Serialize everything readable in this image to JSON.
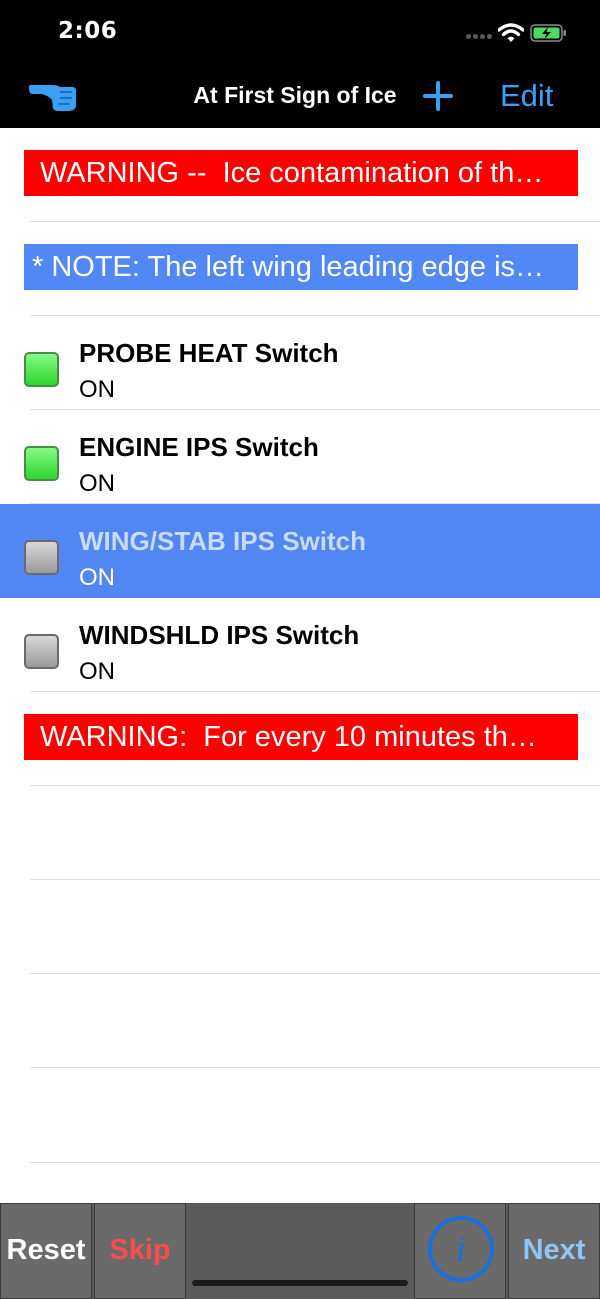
{
  "status_bar": {
    "time": "2:06"
  },
  "nav": {
    "title": "At First Sign of Ice",
    "edit_label": "Edit"
  },
  "rows": [
    {
      "kind": "banner",
      "color": "#ff0000",
      "text": "WARNING --  Ice contamination of th…"
    },
    {
      "kind": "banner",
      "color": "#5288f5",
      "text": "* NOTE: The left wing leading edge is…"
    },
    {
      "kind": "item",
      "title": "PROBE HEAT Switch",
      "value": "ON",
      "checked": true
    },
    {
      "kind": "item",
      "title": "ENGINE IPS Switch",
      "value": "ON",
      "checked": true
    },
    {
      "kind": "item",
      "title": "WING/STAB IPS Switch",
      "value": "ON",
      "checked": false,
      "selected": true
    },
    {
      "kind": "item",
      "title": "WINDSHLD IPS Switch",
      "value": "ON",
      "checked": false
    },
    {
      "kind": "banner",
      "color": "#ff0000",
      "text": "WARNING:  For every 10 minutes th…"
    }
  ],
  "toolbar": {
    "reset_label": "Reset",
    "skip_label": "Skip",
    "info_label": "i",
    "next_label": "Next"
  },
  "colors": {
    "accent": "#3aa0f5",
    "selected_row": "#5286f2",
    "warning": "#ff0000",
    "note": "#5288f5",
    "checked": "#2cd62c"
  }
}
